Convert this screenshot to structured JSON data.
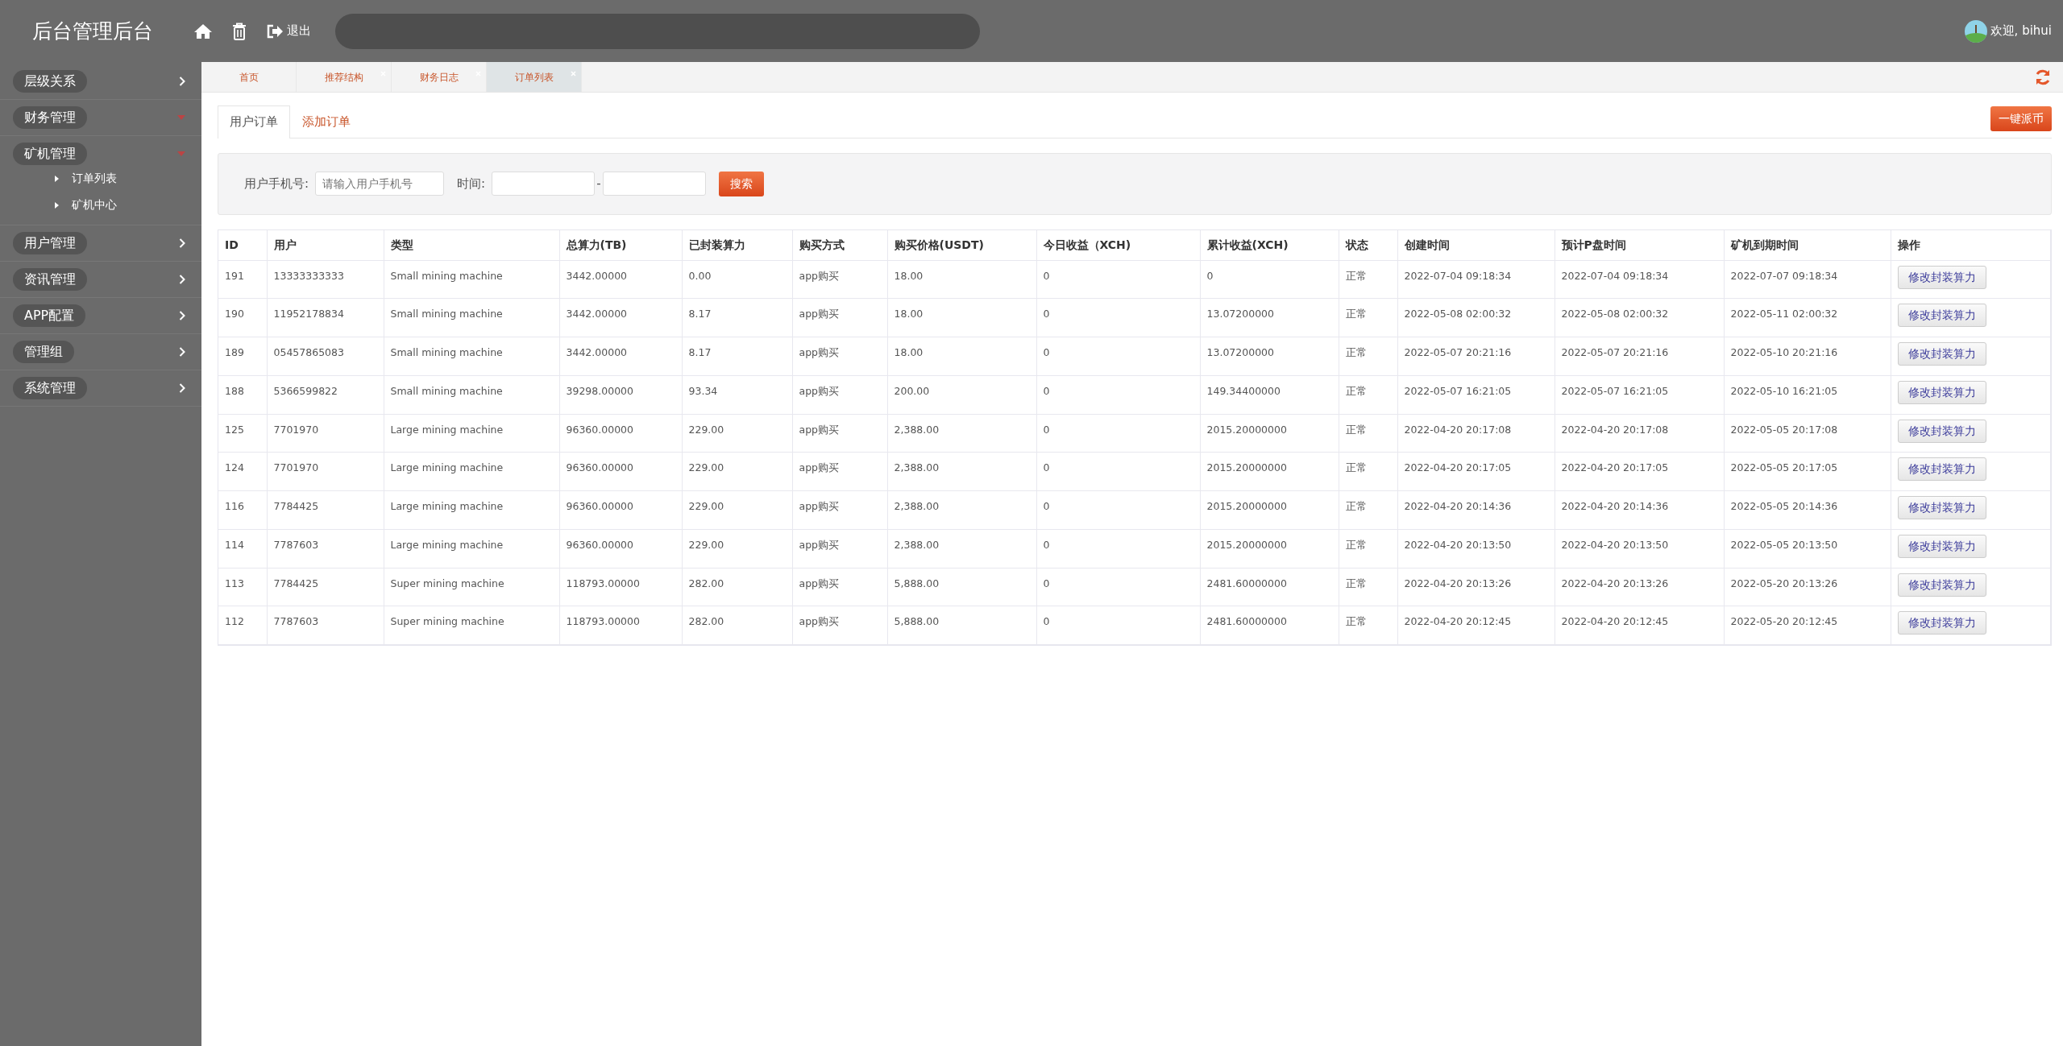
{
  "header": {
    "title": "后台管理后台",
    "logout": "退出",
    "user": "欢迎, bihui"
  },
  "sidebar": {
    "items": [
      {
        "label": "层级关系",
        "expanded": false
      },
      {
        "label": "财务管理",
        "expanded": true
      },
      {
        "label": "矿机管理",
        "expanded": true,
        "children": [
          {
            "label": "订单列表"
          },
          {
            "label": "矿机中心"
          }
        ]
      },
      {
        "label": "用户管理",
        "expanded": false
      },
      {
        "label": "资讯管理",
        "expanded": false
      },
      {
        "label": "APP配置",
        "expanded": false
      },
      {
        "label": "管理组",
        "expanded": false
      },
      {
        "label": "系统管理",
        "expanded": false
      }
    ]
  },
  "page_tabs": [
    {
      "label": "首页",
      "closable": false,
      "selected": false
    },
    {
      "label": "推荐结构",
      "closable": true,
      "selected": false
    },
    {
      "label": "财务日志",
      "closable": true,
      "selected": false
    },
    {
      "label": "订单列表",
      "closable": true,
      "selected": true
    }
  ],
  "sub_tabs": [
    {
      "label": "用户订单",
      "selected": true
    },
    {
      "label": "添加订单",
      "selected": false
    }
  ],
  "action_button": "一键派币",
  "filter": {
    "phone_label": "用户手机号:",
    "phone_placeholder": "请输入用户手机号",
    "time_label": "时间:",
    "separator": "-",
    "search": "搜索"
  },
  "table": {
    "columns": [
      "ID",
      "用户",
      "类型",
      "总算力(TB)",
      "已封装算力",
      "购买方式",
      "购买价格(USDT)",
      "今日收益（XCH)",
      "累计收益(XCH)",
      "状态",
      "创建时间",
      "预计P盘时间",
      "矿机到期时间",
      "操作"
    ],
    "rows": [
      [
        "191",
        "13333333333",
        "Small mining machine",
        "3442.00000",
        "0.00",
        "app购买",
        "18.00",
        "0",
        "0",
        "正常",
        "2022-07-04 09:18:34",
        "2022-07-04 09:18:34",
        "2022-07-07 09:18:34",
        "修改封装算力"
      ],
      [
        "190",
        "11952178834",
        "Small mining machine",
        "3442.00000",
        "8.17",
        "app购买",
        "18.00",
        "0",
        "13.07200000",
        "正常",
        "2022-05-08 02:00:32",
        "2022-05-08 02:00:32",
        "2022-05-11 02:00:32",
        "修改封装算力"
      ],
      [
        "189",
        "05457865083",
        "Small mining machine",
        "3442.00000",
        "8.17",
        "app购买",
        "18.00",
        "0",
        "13.07200000",
        "正常",
        "2022-05-07 20:21:16",
        "2022-05-07 20:21:16",
        "2022-05-10 20:21:16",
        "修改封装算力"
      ],
      [
        "188",
        "5366599822",
        "Small mining machine",
        "39298.00000",
        "93.34",
        "app购买",
        "200.00",
        "0",
        "149.34400000",
        "正常",
        "2022-05-07 16:21:05",
        "2022-05-07 16:21:05",
        "2022-05-10 16:21:05",
        "修改封装算力"
      ],
      [
        "125",
        "7701970",
        "Large mining machine",
        "96360.00000",
        "229.00",
        "app购买",
        "2,388.00",
        "0",
        "2015.20000000",
        "正常",
        "2022-04-20 20:17:08",
        "2022-04-20 20:17:08",
        "2022-05-05 20:17:08",
        "修改封装算力"
      ],
      [
        "124",
        "7701970",
        "Large mining machine",
        "96360.00000",
        "229.00",
        "app购买",
        "2,388.00",
        "0",
        "2015.20000000",
        "正常",
        "2022-04-20 20:17:05",
        "2022-04-20 20:17:05",
        "2022-05-05 20:17:05",
        "修改封装算力"
      ],
      [
        "116",
        "7784425",
        "Large mining machine",
        "96360.00000",
        "229.00",
        "app购买",
        "2,388.00",
        "0",
        "2015.20000000",
        "正常",
        "2022-04-20 20:14:36",
        "2022-04-20 20:14:36",
        "2022-05-05 20:14:36",
        "修改封装算力"
      ],
      [
        "114",
        "7787603",
        "Large mining machine",
        "96360.00000",
        "229.00",
        "app购买",
        "2,388.00",
        "0",
        "2015.20000000",
        "正常",
        "2022-04-20 20:13:50",
        "2022-04-20 20:13:50",
        "2022-05-05 20:13:50",
        "修改封装算力"
      ],
      [
        "113",
        "7784425",
        "Super mining machine",
        "118793.00000",
        "282.00",
        "app购买",
        "5,888.00",
        "0",
        "2481.60000000",
        "正常",
        "2022-04-20 20:13:26",
        "2022-04-20 20:13:26",
        "2022-05-20 20:13:26",
        "修改封装算力"
      ],
      [
        "112",
        "7787603",
        "Super mining machine",
        "118793.00000",
        "282.00",
        "app购买",
        "5,888.00",
        "0",
        "2481.60000000",
        "正常",
        "2022-04-20 20:12:45",
        "2022-04-20 20:12:45",
        "2022-05-20 20:12:45",
        "修改封装算力"
      ]
    ]
  }
}
